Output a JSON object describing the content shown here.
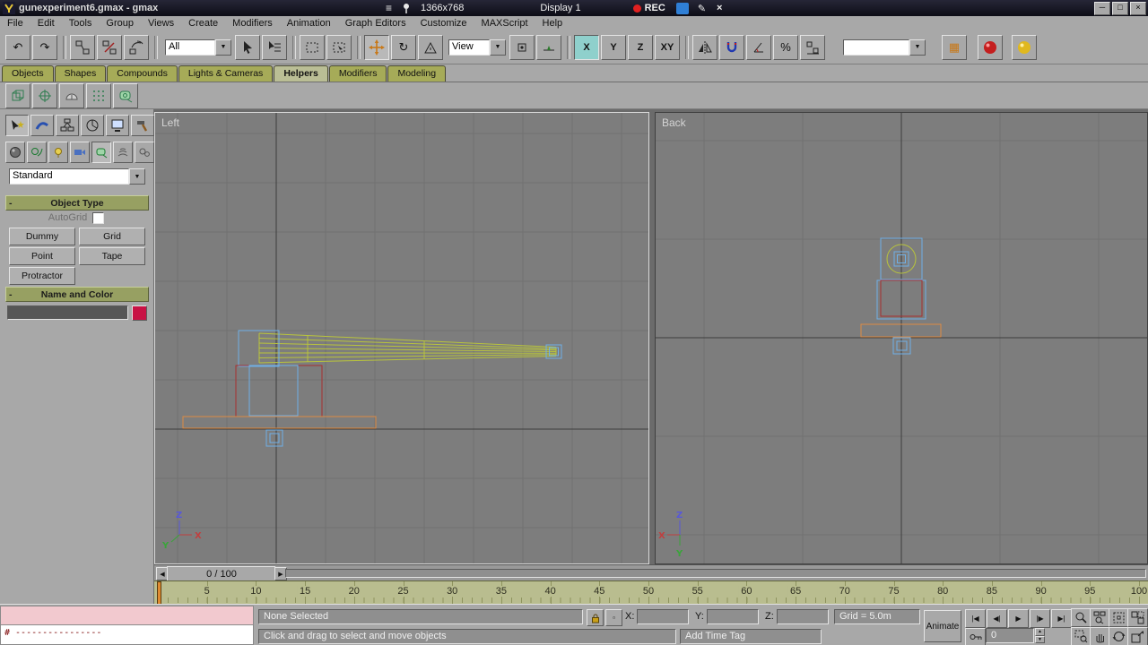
{
  "colors": {
    "wire_blue": "#6fb0e6",
    "wire_yellow": "#b9c43c",
    "wire_red": "#a83030",
    "wire_orange": "#dd8a44",
    "swatch_red": "#c81244",
    "rec_red": "#e02020",
    "overlay_blue": "#2f7fd6",
    "marker_orange": "#e08a30",
    "axis_red": "#c04040",
    "axis_green": "#3aa43a",
    "axis_blue": "#5858d8"
  },
  "window": {
    "title": "gunexperiment6.gmax - gmax",
    "overlay": {
      "menu_icon": "≡",
      "resolution": "1366x768",
      "display": "Display 1",
      "rec_label": "REC",
      "pencil_icon": "✎",
      "close_icon": "×"
    },
    "controls": {
      "minimize": "─",
      "maximize": "□",
      "close": "×"
    }
  },
  "menu_bar": [
    "File",
    "Edit",
    "Tools",
    "Group",
    "Views",
    "Create",
    "Modifiers",
    "Animation",
    "Graph Editors",
    "Customize",
    "MAXScript",
    "Help"
  ],
  "toolbar": {
    "filter_value": "All",
    "coord_value": "View",
    "sets_value": "",
    "axis": [
      "X",
      "Y",
      "Z",
      "XY"
    ]
  },
  "icons": {
    "undo": "↶",
    "redo": "↷",
    "rotate": "↻",
    "combo_arrow": "▼",
    "percent": "%",
    "arrow_left": "◀",
    "arrow_right": "▶",
    "schematic": "▦",
    "square": "▫"
  },
  "tabs": [
    {
      "label": "Objects",
      "active": false
    },
    {
      "label": "Shapes",
      "active": false
    },
    {
      "label": "Compounds",
      "active": false
    },
    {
      "label": "Lights & Cameras",
      "active": false
    },
    {
      "label": "Helpers",
      "active": true
    },
    {
      "label": "Modifiers",
      "active": false
    },
    {
      "label": "Modeling",
      "active": false
    }
  ],
  "command_panel": {
    "dropdown_value": "Standard",
    "object_type": {
      "title": "Object Type",
      "autogrid": "AutoGrid",
      "buttons": [
        "Dummy",
        "Grid",
        "Point",
        "Tape",
        "Protractor"
      ]
    },
    "name_color": {
      "title": "Name and Color",
      "value": ""
    }
  },
  "viewports": {
    "left": {
      "label": "Left",
      "axis": {
        "x": "X",
        "y": "Y",
        "z": "Z"
      }
    },
    "back": {
      "label": "Back",
      "axis": {
        "x": "X",
        "y": "Y",
        "z": "Z"
      }
    }
  },
  "time_slider": {
    "label": "0 / 100"
  },
  "ruler": {
    "labels": [
      5,
      10,
      15,
      20,
      25,
      30,
      35,
      40,
      45,
      50,
      55,
      60,
      65,
      70,
      75,
      80,
      85,
      90,
      95,
      100
    ]
  },
  "playback": [
    "|◀",
    "◀|",
    "▶",
    "|▶",
    "▶|"
  ],
  "status": {
    "listener_line": "# ----------------",
    "selection": "None Selected",
    "x_label": "X:",
    "y_label": "Y:",
    "z_label": "Z:",
    "grid": "Grid = 5.0m",
    "prompt": "Click and drag to select and move objects",
    "time_tag": "Add Time Tag",
    "animate": "Animate",
    "frame": "0"
  }
}
